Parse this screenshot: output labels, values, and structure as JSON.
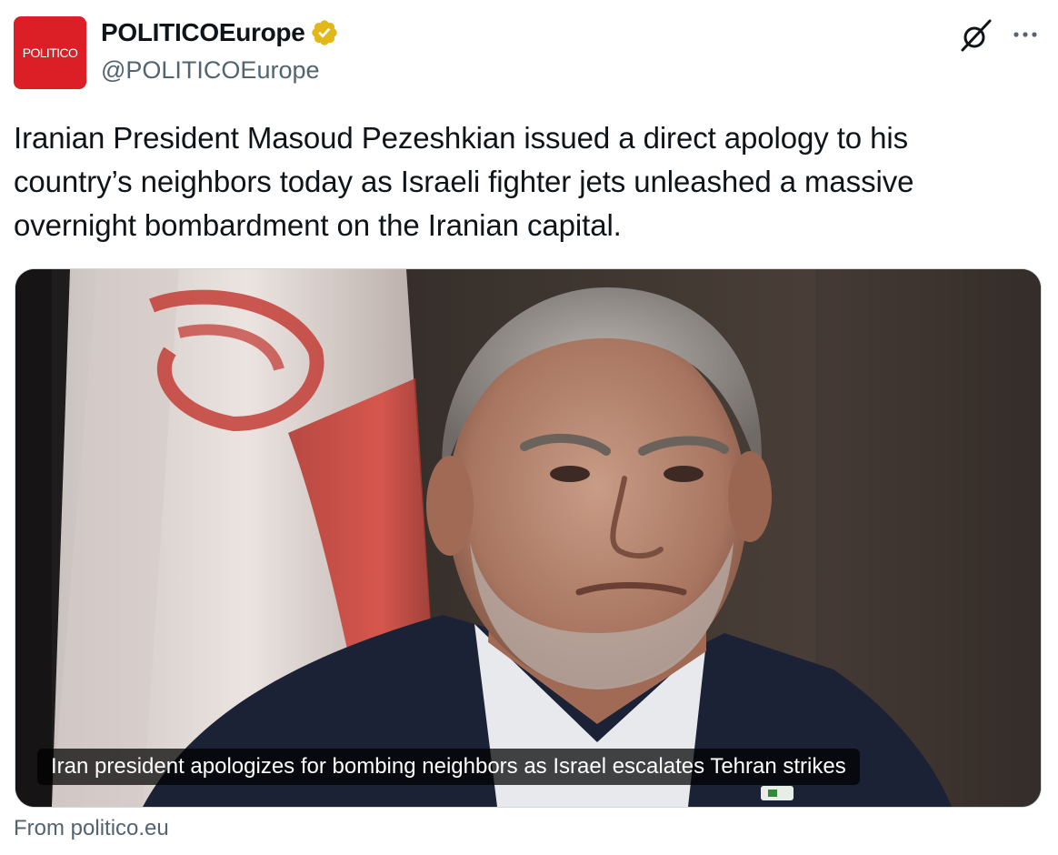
{
  "author": {
    "avatar_text": "POLITICO",
    "display_name": "POLITICOEurope",
    "handle": "@POLITICOEurope",
    "verified": true,
    "verified_color": "#e2b719"
  },
  "header_actions": {
    "grok_icon": "grok-icon",
    "more_icon": "more-icon"
  },
  "tweet": {
    "text": "Iranian President Masoud Pezeshkian issued a direct apology to his country’s neighbors today as Israeli fighter jets unleashed a massive overnight bombardment on the Iranian capital."
  },
  "link_card": {
    "title": "Iran president apologizes for bombing neighbors as Israel escalates Tehran strikes",
    "source": "From politico.eu"
  },
  "colors": {
    "brand_red": "#dc1f26",
    "secondary_text": "#536471",
    "primary_text": "#0f1419"
  }
}
